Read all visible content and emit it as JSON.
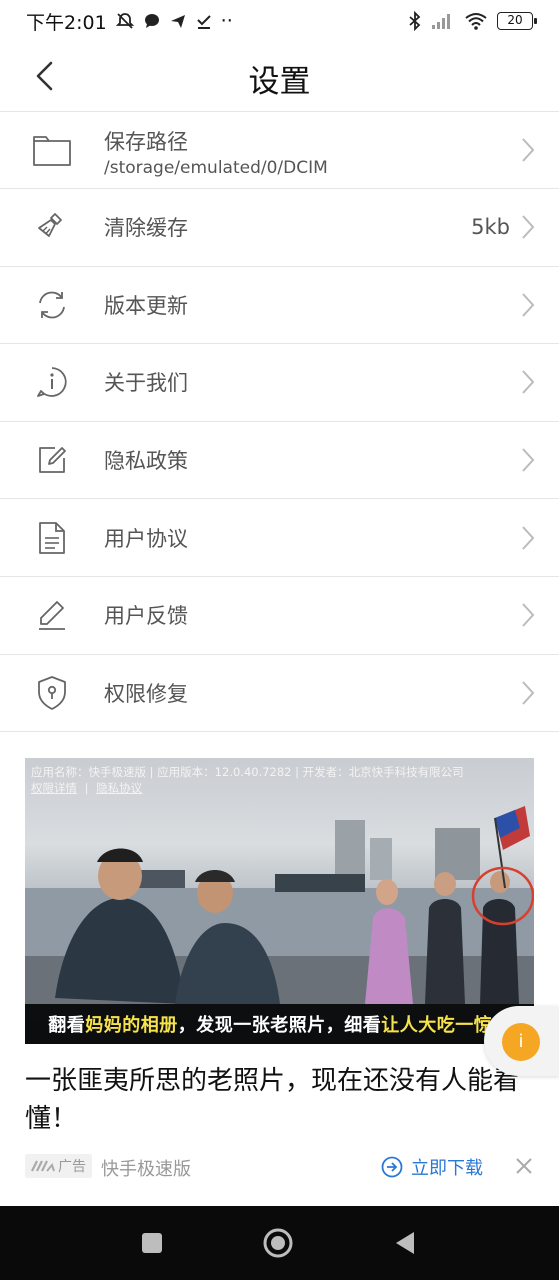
{
  "status_bar": {
    "time": "下午2:01",
    "dots": "··",
    "battery": "20"
  },
  "header": {
    "title": "设置"
  },
  "settings": {
    "items": [
      {
        "label": "保存路径",
        "subtitle": "/storage/emulated/0/DCIM",
        "icon": "folder-icon"
      },
      {
        "label": "清除缓存",
        "value": "5kb",
        "icon": "broom-icon"
      },
      {
        "label": "版本更新",
        "icon": "refresh-icon"
      },
      {
        "label": "关于我们",
        "icon": "info-icon"
      },
      {
        "label": "隐私政策",
        "icon": "edit-document-icon"
      },
      {
        "label": "用户协议",
        "icon": "document-icon"
      },
      {
        "label": "用户反馈",
        "icon": "pen-icon"
      },
      {
        "label": "权限修复",
        "icon": "shield-icon"
      }
    ]
  },
  "ad": {
    "meta_line1": "应用名称：快手极速版 | 应用版本：12.0.40.7282 | 开发者：北京快手科技有限公司",
    "meta_link1": "权限详情",
    "meta_sep": "|",
    "meta_link2": "隐私协议",
    "caption_part1": "翻看",
    "caption_highlight": "妈妈的相册",
    "caption_part2": "，发现一张老照片，细看",
    "caption_highlight2": "让人大吃一惊！",
    "title": "一张匪夷所思的老照片，现在还没有人能看懂！",
    "badge": "广告",
    "source": "快手极速版",
    "download": "立即下载"
  },
  "colors": {
    "accent_blue": "#2a78d6",
    "caption_highlight": "#f6e24b",
    "float_orange": "#f5a623"
  }
}
